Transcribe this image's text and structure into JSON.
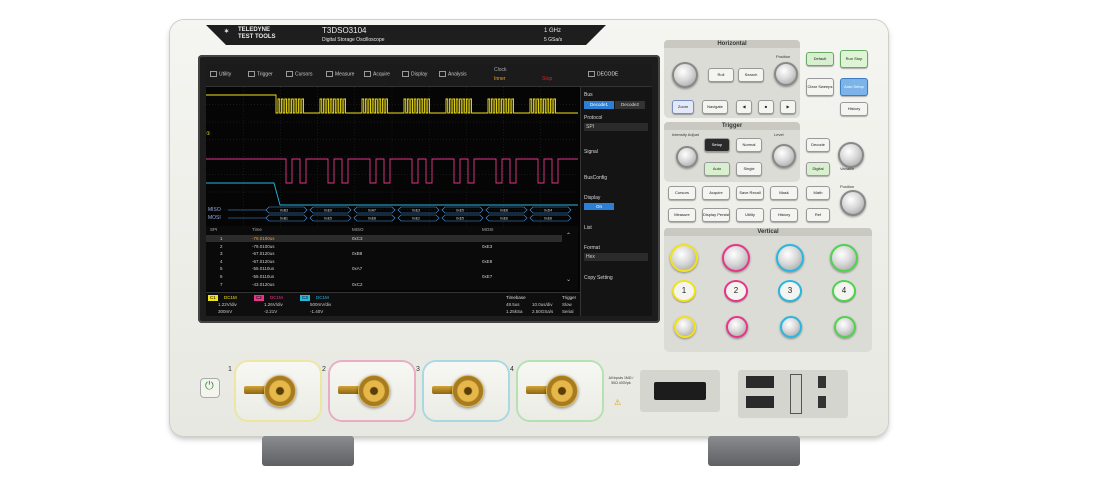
{
  "brand": {
    "name_line1": "TELEDYNE",
    "name_line2": "TEST TOOLS",
    "model": "T3DSO3104",
    "subtitle": "Digital Storage Oscilloscope",
    "spec_bw": "1 GHz",
    "spec_sr": "5 GSa/s"
  },
  "menubar": {
    "items": [
      "Utility",
      "Trigger",
      "Cursors",
      "Measure",
      "Acquire",
      "Display",
      "Analysis"
    ],
    "clock_label": "Clock",
    "clock_value": "Inner",
    "status": "Stop",
    "panel_title": "DECODE"
  },
  "colors": {
    "ch1": "#f2e21a",
    "ch2": "#e8348a",
    "ch3": "#27b7e0",
    "ch4": "#4fd24f",
    "bus": "#4a9be8"
  },
  "decode_panel": {
    "bus_label": "Bus",
    "bus_tabs": [
      "Decode1",
      "Decode2"
    ],
    "protocol_label": "Protocol",
    "protocol_value": "SPI",
    "signal_label": "Signal",
    "busconfig_label": "BusConfig",
    "display_label": "Display",
    "display_value": "On",
    "list_label": "List",
    "format_label": "Format",
    "format_value": "Hex",
    "copy_label": "Copy Setting"
  },
  "bus_lanes": {
    "miso_label": "MISO",
    "mosi_label": "MOSI",
    "miso_values": [
      "0xB3",
      "0xE0",
      "0xA7",
      "0xE3",
      "0xE5",
      "0xE8",
      "0xD4"
    ],
    "mosi_values": [
      "0xB1",
      "0xE5",
      "0xE8",
      "0xE2",
      "0xE5",
      "0xE6",
      "0xE8"
    ]
  },
  "table": {
    "headers": [
      "SPI",
      "Time",
      "MISO",
      "MOSI"
    ],
    "rows": [
      {
        "idx": "1",
        "time": "-79.0100us",
        "miso": "0xC3",
        "mosi": ""
      },
      {
        "idx": "2",
        "time": "-79.0100us",
        "miso": "",
        "mosi": "0xE3"
      },
      {
        "idx": "3",
        "time": "-67.0120us",
        "miso": "0xB8",
        "mosi": ""
      },
      {
        "idx": "4",
        "time": "-67.0120us",
        "miso": "",
        "mosi": "0xE8"
      },
      {
        "idx": "5",
        "time": "-55.0110us",
        "miso": "0xA7",
        "mosi": ""
      },
      {
        "idx": "6",
        "time": "-55.0110us",
        "miso": "",
        "mosi": "0xE7"
      },
      {
        "idx": "7",
        "time": "-43.0120us",
        "miso": "0xC2",
        "mosi": ""
      }
    ]
  },
  "statusbar": {
    "ch1": {
      "label": "C1",
      "coupling": "DC1M",
      "scale": "1.22V/div",
      "offset": "300mV"
    },
    "ch2": {
      "label": "C2",
      "coupling": "DC1M",
      "scale": "1.26V/div",
      "offset": "-2.21V"
    },
    "ch3": {
      "label": "C3",
      "coupling": "DC1M",
      "scale": "500mV/div",
      "offset": "-1.40V"
    },
    "timebase_label": "Timebase",
    "timebase_delay": "48.5us",
    "timebase_scale": "10.0us/div",
    "samples": "1.25kSa",
    "sample_rate": "2.50GSa/s",
    "trigger_label": "Trigger",
    "trigger_type": "Slow",
    "trigger_mode": "Serial",
    "clock_time": "19:20:26",
    "clock_date": "2020/1/3"
  },
  "panel": {
    "horizontal_title": "Horizontal",
    "trigger_title": "Trigger",
    "vertical_title": "Vertical",
    "buttons": {
      "default": "Default",
      "run_stop": "Run Stop",
      "roll": "Roll",
      "search": "Search",
      "clear_sweeps": "Clear Sweeps",
      "auto_setup": "Auto Setup",
      "zoom": "Zoom",
      "navigate": "Navigate",
      "history": "History",
      "setup": "Setup",
      "normal": "Normal",
      "auto": "Auto",
      "single": "Single",
      "decode": "Decode",
      "digital": "Digital",
      "cursors": "Cursors",
      "acquire": "Acquire",
      "save_recall": "Save Recall",
      "math": "Math",
      "measure": "Measure",
      "display_persist": "Display Persist",
      "utility": "Utility",
      "ref": "Ref",
      "mask": "Mask"
    },
    "knob_labels": {
      "intensity": "Intensity Adjust",
      "position": "Position",
      "level": "Level",
      "variable": "Variable"
    },
    "channel_buttons": [
      "1",
      "2",
      "3",
      "4"
    ]
  },
  "front": {
    "channel_numbers": [
      "1",
      "2",
      "3",
      "4"
    ],
    "warning_text": "All Inputs 1MΩ / 50Ω 400Vpk"
  }
}
